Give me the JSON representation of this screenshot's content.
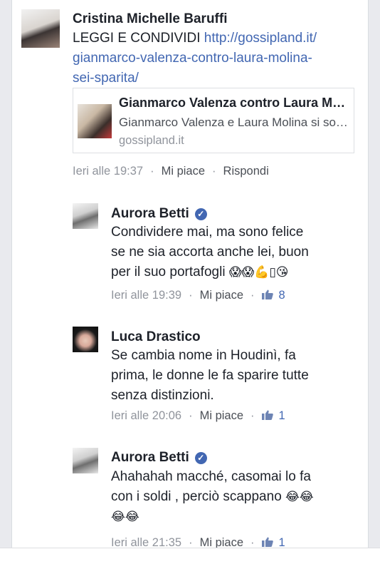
{
  "post": {
    "author": "Cristina Michelle Baruffi",
    "text_prefix": "LEGGI E CONDIVIDI ",
    "link_line1": "http://gossipland.it/",
    "link_line2": "gianmarco-valenza-contro-laura-molina-",
    "link_line3": "sei-sparita/",
    "preview": {
      "title": "Gianmarco Valenza contro Laura Molina: \"Sei sparita!\"",
      "description": "Gianmarco Valenza e Laura Molina si sono lasciati",
      "domain": "gossipland.it"
    },
    "time": "Ieri alle 19:37",
    "like_label": "Mi piace",
    "reply_label": "Rispondi"
  },
  "comments": [
    {
      "author": "Aurora Betti",
      "verified": true,
      "lines": [
        "Condividere mai, ma sono felice",
        "se ne sia accorta anche lei, buon",
        "per il suo portafogli"
      ],
      "emojis": "😱😱💪▯😘",
      "time": "Ieri alle 19:39",
      "like_label": "Mi piace",
      "likes": "8"
    },
    {
      "author": "Luca Drastico",
      "verified": false,
      "lines": [
        "Se cambia nome in Houdinì, fa",
        "prima, le donne le fa sparire tutte",
        "senza distinzioni."
      ],
      "time": "Ieri alle 20:06",
      "like_label": "Mi piace",
      "likes": "1"
    },
    {
      "author": "Aurora Betti",
      "verified": true,
      "lines": [
        "Ahahahah macché, casomai lo fa",
        "con i soldi , perciò scappano"
      ],
      "emojis_line2": "😂😂",
      "emojis_line3": "😂😂",
      "time": "Ieri alle 21:35",
      "like_label": "Mi piace",
      "likes": "1"
    }
  ],
  "colors": {
    "link": "#4267b2",
    "text": "#1d2129",
    "meta": "#90949c",
    "verified": "#4267b2"
  },
  "icons": {
    "verified": "verified-check-icon",
    "like": "thumbs-up-icon"
  }
}
